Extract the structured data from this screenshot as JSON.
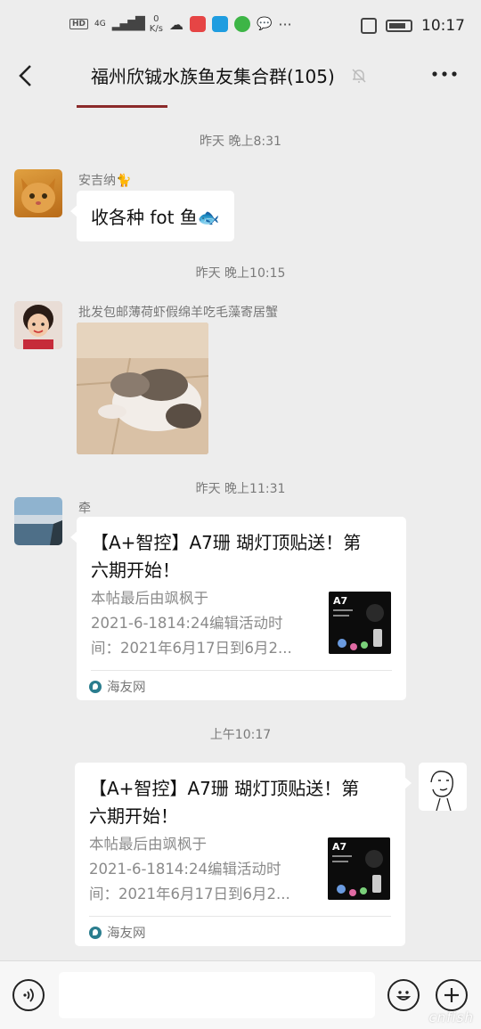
{
  "status_bar": {
    "hd": "HD",
    "network": "4G",
    "speed_value": "0",
    "speed_unit": "K/s",
    "more_dots": "···",
    "time": "10:17",
    "app_icon_colors": [
      "#e64545",
      "#1f9de0",
      "#3db546",
      "#444444"
    ]
  },
  "header": {
    "back_icon": "chevron-left-icon",
    "title": "福州欣铖水族鱼友集合群(105)",
    "mute_icon": "bell-muted-icon",
    "more_icon": "more-dots-icon"
  },
  "messages": {
    "ts1": "昨天 晚上8:31",
    "m1_nick": "安吉纳🐈",
    "m1_text": "收各种 fot 鱼🐟",
    "ts2": "昨天 晚上10:15",
    "m2_nick": "批发包邮薄荷虾假绵羊吃毛藻寄居蟹",
    "ts3": "昨天 晚上11:31",
    "m3_nick": "牵",
    "card1": {
      "title_line1": "【A+智控】A7珊 瑚灯顶贴送！第",
      "title_line2": "六期开始！",
      "desc_line1": "本帖最后由飒枫于",
      "desc_line2": "2021-6-1814:24编辑活动时",
      "desc_line3": "间：2021年6月17日到6月2...",
      "thumb_label": "A7",
      "source": "海友网"
    },
    "ts4": "上午10:17",
    "card2": {
      "title_line1": "【A+智控】A7珊 瑚灯顶贴送！第",
      "title_line2": "六期开始！",
      "desc_line1": "本帖最后由飒枫于",
      "desc_line2": "2021-6-1814:24编辑活动时",
      "desc_line3": "间：2021年6月17日到6月2...",
      "thumb_label": "A7",
      "source": "海友网"
    }
  },
  "input_bar": {
    "voice_icon": "voice-icon",
    "emoji_icon": "emoji-icon",
    "plus_icon": "plus-icon",
    "input_value": ""
  },
  "watermark": "cnfish"
}
